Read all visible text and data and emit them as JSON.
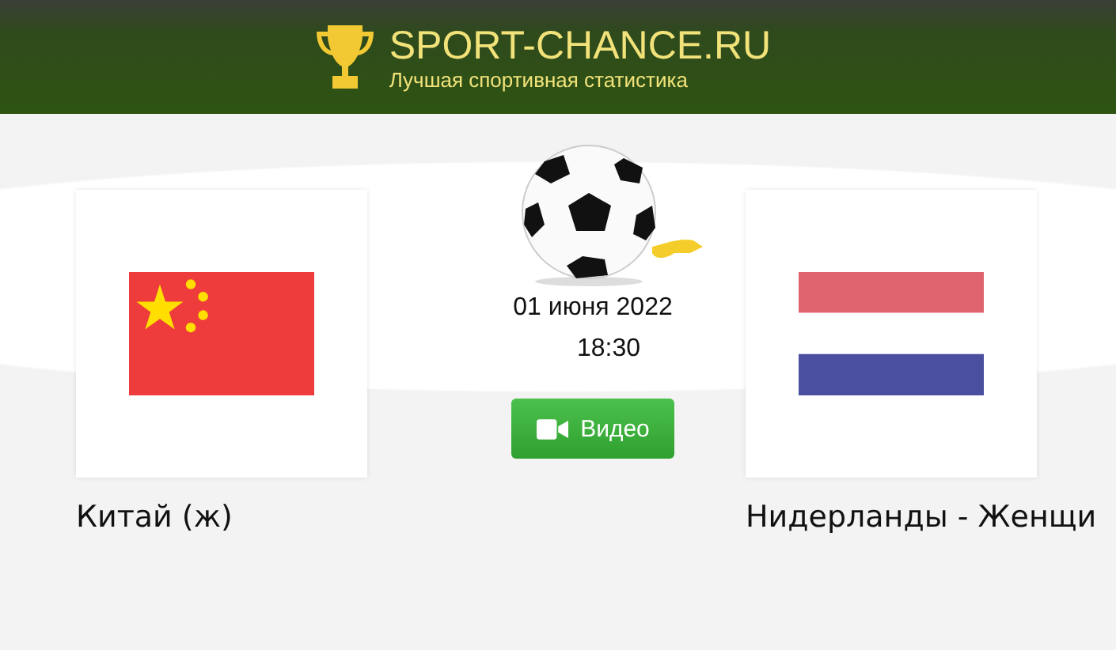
{
  "header": {
    "site_name": "SPORT-CHANCE.RU",
    "tagline": "Лучшая спортивная статистика"
  },
  "match": {
    "date": "01 июня 2022",
    "time": "18:30",
    "video_button": "Видео"
  },
  "teams": [
    {
      "name": "Китай (ж)",
      "kind": "china"
    },
    {
      "name": "Нидерланды - Женщи",
      "kind": "netherlands"
    }
  ]
}
